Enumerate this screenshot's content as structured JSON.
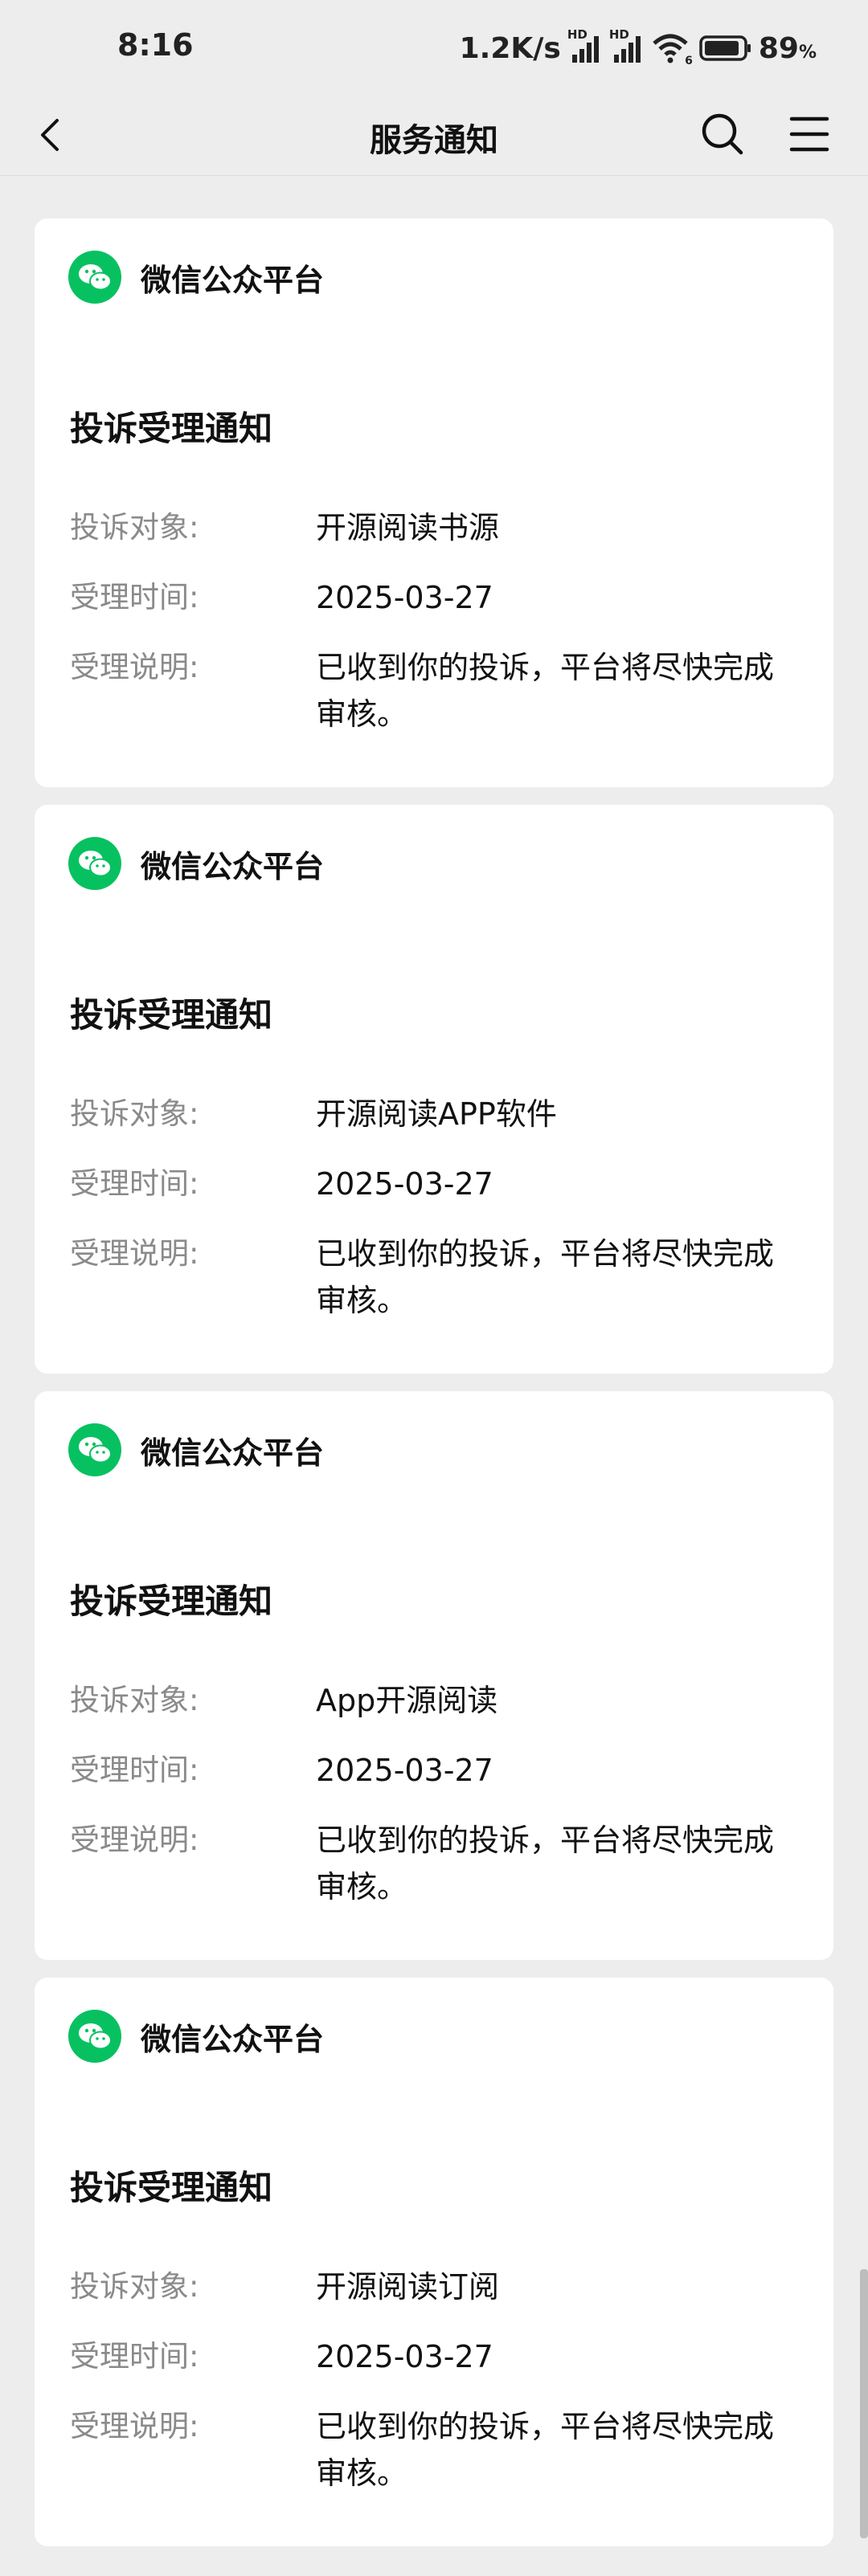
{
  "status_bar": {
    "time": "8:16",
    "network_speed": "1.2K/s",
    "signal_1_label": "HD",
    "signal_2_label": "HD",
    "wifi_badge": "6",
    "battery": "89",
    "battery_unit": "%"
  },
  "nav": {
    "title": "服务通知"
  },
  "cards": [
    {
      "source": "微信公众平台",
      "title": "投诉受理通知",
      "fields": [
        {
          "label": "投诉对象:",
          "value": "开源阅读书源"
        },
        {
          "label": "受理时间:",
          "value": "2025-03-27"
        },
        {
          "label": "受理说明:",
          "value": "已收到你的投诉，平台将尽快完成审核。"
        }
      ]
    },
    {
      "source": "微信公众平台",
      "title": "投诉受理通知",
      "fields": [
        {
          "label": "投诉对象:",
          "value": "开源阅读APP软件"
        },
        {
          "label": "受理时间:",
          "value": "2025-03-27"
        },
        {
          "label": "受理说明:",
          "value": "已收到你的投诉，平台将尽快完成审核。"
        }
      ]
    },
    {
      "source": "微信公众平台",
      "title": "投诉受理通知",
      "fields": [
        {
          "label": "投诉对象:",
          "value": "App开源阅读"
        },
        {
          "label": "受理时间:",
          "value": "2025-03-27"
        },
        {
          "label": "受理说明:",
          "value": "已收到你的投诉，平台将尽快完成审核。"
        }
      ]
    },
    {
      "source": "微信公众平台",
      "title": "投诉受理通知",
      "fields": [
        {
          "label": "投诉对象:",
          "value": "开源阅读订阅"
        },
        {
          "label": "受理时间:",
          "value": "2025-03-27"
        },
        {
          "label": "受理说明:",
          "value": "已收到你的投诉，平台将尽快完成审核。"
        }
      ]
    }
  ],
  "colors": {
    "background": "#ededed",
    "card": "#ffffff",
    "wechat_green": "#07c160",
    "label_gray": "#8a8a8a"
  },
  "icons": [
    "back-arrow-icon",
    "search-icon",
    "menu-icon",
    "wechat-icon",
    "signal-icon",
    "wifi-icon",
    "battery-icon"
  ]
}
